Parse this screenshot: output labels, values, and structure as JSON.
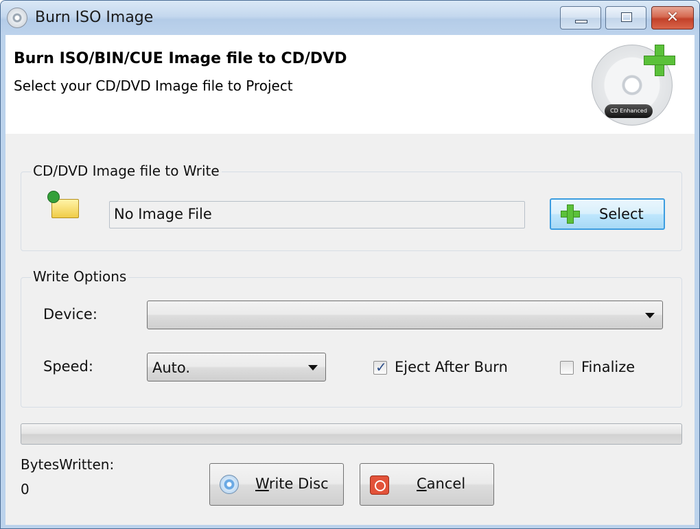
{
  "window": {
    "title": "Burn ISO Image",
    "controls": {
      "minimize": "minimize",
      "maximize": "maximize",
      "close": "close"
    }
  },
  "header": {
    "title": "Burn ISO/BIN/CUE Image file to CD/DVD",
    "subtitle": "Select your CD/DVD Image file to Project",
    "badge": "CD Enhanced"
  },
  "image_group": {
    "legend": "CD/DVD Image file to Write",
    "file_value": "No Image File",
    "select_button": "Select"
  },
  "options_group": {
    "legend": "Write Options",
    "device_label": "Device:",
    "device_value": "",
    "speed_label": "Speed:",
    "speed_value": "Auto.",
    "eject_label": "Eject After Burn",
    "eject_checked": true,
    "finalize_label": "Finalize",
    "finalize_checked": false
  },
  "progress": {
    "value": 0
  },
  "status": {
    "bytes_label": "BytesWritten:",
    "bytes_value": "0"
  },
  "buttons": {
    "write_prefix": "W",
    "write_rest": "rite Disc",
    "cancel_prefix": "C",
    "cancel_rest": "ancel"
  },
  "icons": {
    "app": "cd-icon",
    "header": "cd-plus-icon",
    "folder": "folder-open-icon",
    "select": "plus-icon",
    "write": "disc-icon",
    "cancel": "stop-icon"
  },
  "colors": {
    "accent": "#3c9de0",
    "plus_green": "#5bc13a",
    "cancel_red": "#e2533a"
  }
}
